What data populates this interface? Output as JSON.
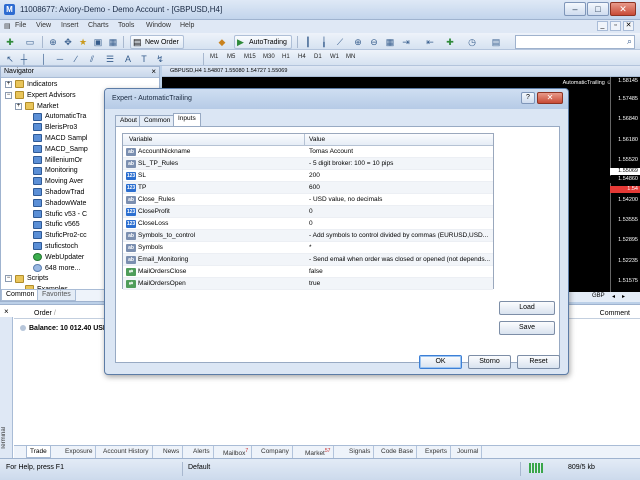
{
  "window": {
    "app_icon": "mt4-icon",
    "title": "11008677: Axiory-Demo - Demo Account - [GBPUSD,H4]",
    "minimize": "–",
    "maximize": "□",
    "close": "✕"
  },
  "menu": {
    "items": [
      "File",
      "View",
      "Insert",
      "Charts",
      "Tools",
      "Window",
      "Help"
    ],
    "right": [
      "_",
      "▫",
      "✕"
    ]
  },
  "toolbar": {
    "new_order_label": "New Order",
    "autotrading_label": "AutoTrading",
    "timeframes": [
      "M1",
      "M5",
      "M15",
      "M30",
      "H1",
      "H4",
      "D1",
      "W1",
      "MN"
    ]
  },
  "navigator": {
    "title": "Navigator",
    "close": "×",
    "items": [
      {
        "label": "Indicators",
        "icon": "folder"
      },
      {
        "label": "Expert Advisors",
        "icon": "folder"
      },
      {
        "label": "Market",
        "icon": "folder"
      },
      {
        "label": "AutomaticTra",
        "icon": "ea"
      },
      {
        "label": "BlerisPro3",
        "icon": "ea"
      },
      {
        "label": "MACD Sampl",
        "icon": "ea"
      },
      {
        "label": "MACD_Samp",
        "icon": "ea"
      },
      {
        "label": "MilleniumOr",
        "icon": "ea"
      },
      {
        "label": "Monitoring",
        "icon": "ea"
      },
      {
        "label": "Moving Aver",
        "icon": "ea"
      },
      {
        "label": "ShadowTrad",
        "icon": "ea"
      },
      {
        "label": "ShadowWate",
        "icon": "ea"
      },
      {
        "label": "Stufic v53 - C",
        "icon": "ea"
      },
      {
        "label": "Stufic v565",
        "icon": "ea"
      },
      {
        "label": "StuficPro2-cc",
        "icon": "ea"
      },
      {
        "label": "stuficstoch",
        "icon": "ea"
      },
      {
        "label": "WebUpdater",
        "icon": "web"
      },
      {
        "label": "648 more...",
        "icon": "gear"
      },
      {
        "label": "Scripts",
        "icon": "folder"
      },
      {
        "label": "Examples",
        "icon": "folder"
      }
    ],
    "tabs": [
      "Common",
      "Favorites"
    ]
  },
  "chart": {
    "info": "GBPUSD,H4  1.54807 1.55080 1.54727 1.55069",
    "ea_label": "AutomaticTrailing ☺",
    "prices": [
      "1.58145",
      "1.57485",
      "1.56840",
      "1.56180",
      "1.55520",
      "1.54860",
      "1.54200",
      "1.53555",
      "1.52895",
      "1.52235",
      "1.51575"
    ],
    "current_price": "1.55069",
    "bid_marker": "1.54860",
    "red_marker": "1.54",
    "tab_label": "GBP"
  },
  "terminal": {
    "close": "×",
    "side_label": "Terminal",
    "order_col": "Order",
    "sort_mark": "/",
    "comment_col": "Comment",
    "balance": "Balance: 10 012.40 USD",
    "tabs": [
      {
        "label": "Trade"
      },
      {
        "label": "Exposure"
      },
      {
        "label": "Account History"
      },
      {
        "label": "News"
      },
      {
        "label": "Alerts"
      },
      {
        "label": "Mailbox",
        "badge": "7"
      },
      {
        "label": "Company"
      },
      {
        "label": "Market",
        "badge": "57"
      },
      {
        "label": "Signals"
      },
      {
        "label": "Code Base"
      },
      {
        "label": "Experts"
      },
      {
        "label": "Journal"
      }
    ]
  },
  "status": {
    "help": "For Help, press F1",
    "profile": "Default",
    "traffic": "809/5 kb"
  },
  "dialog": {
    "title": "Expert - AutomaticTrailing",
    "help": "?",
    "close": "✕",
    "tabs": [
      "About",
      "Common",
      "Inputs"
    ],
    "columns": {
      "variable": "Variable",
      "value": "Value"
    },
    "params": [
      {
        "icon": "ab",
        "icon_text": "ab",
        "name": "AccountNickname",
        "value": "Tomas Account"
      },
      {
        "icon": "ab",
        "icon_text": "ab",
        "name": "SL_TP_Rules",
        "value": "- 5 digit broker: 100 = 10 pips"
      },
      {
        "icon": "v12",
        "icon_text": "123",
        "name": "SL",
        "value": "200"
      },
      {
        "icon": "v12",
        "icon_text": "123",
        "name": "TP",
        "value": "600"
      },
      {
        "icon": "ab",
        "icon_text": "ab",
        "name": "Close_Rules",
        "value": "- USD value, no decimals"
      },
      {
        "icon": "v12",
        "icon_text": "123",
        "name": "CloseProfit",
        "value": "0"
      },
      {
        "icon": "v12",
        "icon_text": "123",
        "name": "CloseLoss",
        "value": "0"
      },
      {
        "icon": "ab",
        "icon_text": "ab",
        "name": "Symbols_to_control",
        "value": "- Add symbols to control divided by commas (EURUSD,USD..."
      },
      {
        "icon": "ab",
        "icon_text": "ab",
        "name": "Symbols",
        "value": "*"
      },
      {
        "icon": "ab",
        "icon_text": "ab",
        "name": "Email_Monitoring",
        "value": "- Send email when order was closed or opened (not depends..."
      },
      {
        "icon": "sw",
        "icon_text": "⇄",
        "name": "MailOrdersClose",
        "value": "false"
      },
      {
        "icon": "sw",
        "icon_text": "⇄",
        "name": "MailOrdersOpen",
        "value": "true"
      }
    ],
    "load": "Load",
    "save": "Save",
    "ok": "OK",
    "cancel": "Storno",
    "reset": "Reset"
  }
}
